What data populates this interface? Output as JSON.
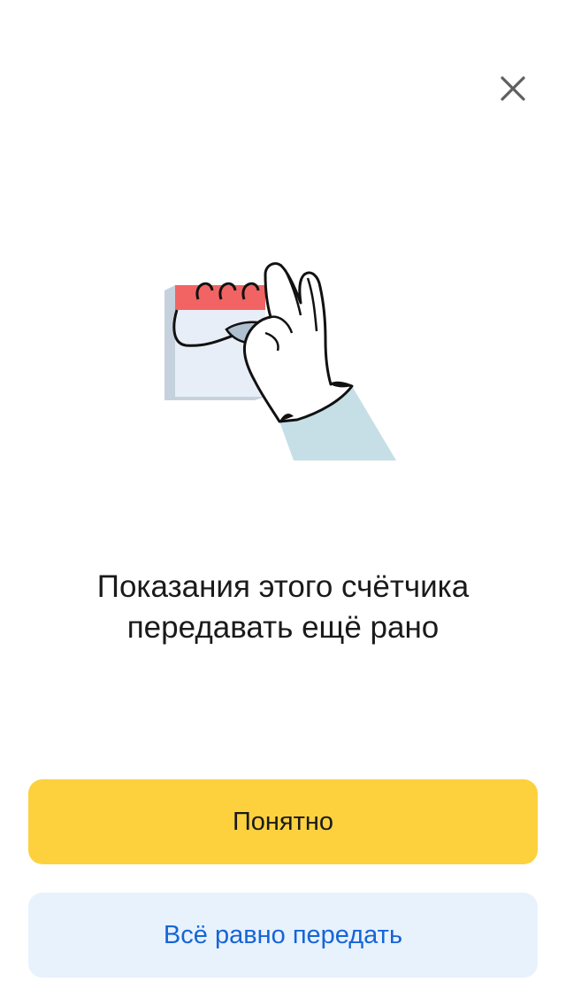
{
  "dialog": {
    "title_line1": "Показания этого счётчика",
    "title_line2": "передавать ещё рано",
    "primary_button_label": "Понятно",
    "secondary_button_label": "Всё равно передать",
    "close_icon": "close-icon",
    "illustration": "calendar-hand-illustration"
  },
  "colors": {
    "primary_button_bg": "#FDD13E",
    "secondary_button_bg": "#E8F2FD",
    "secondary_button_text": "#1565D8",
    "calendar_header": "#F26464",
    "calendar_page": "#E8EEF7",
    "calendar_shadow": "#C5D2DE",
    "sleeve": "#C6DFE6"
  }
}
